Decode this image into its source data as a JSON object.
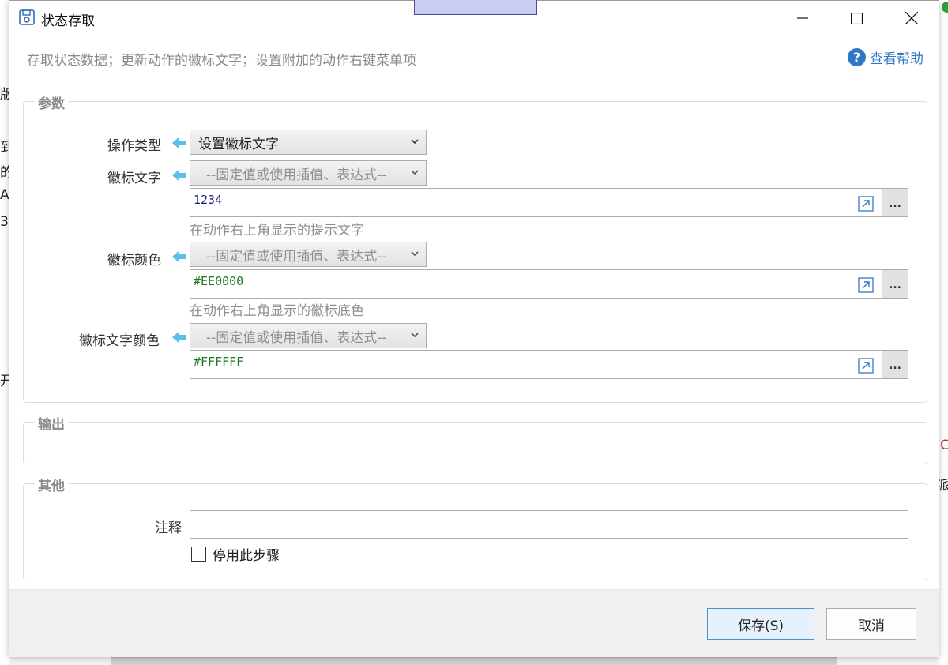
{
  "window": {
    "title": "状态存取",
    "description": "存取状态数据；更新动作的徽标文字；设置附加的动作右键菜单项",
    "help_label": "查看帮助",
    "help_icon": "question-icon"
  },
  "background": {
    "left_chars": [
      "版",
      "到",
      "的",
      "A",
      "3",
      "开"
    ],
    "right_chars": [
      "C",
      "派"
    ]
  },
  "params": {
    "legend": "参数",
    "operation_type": {
      "label": "操作类型",
      "value": "设置徽标文字"
    },
    "badge_text": {
      "label": "徽标文字",
      "mode_placeholder": "--固定值或使用插值、表达式--",
      "value": "1234",
      "hint": "在动作右上角显示的提示文字"
    },
    "badge_color": {
      "label": "徽标颜色",
      "mode_placeholder": "--固定值或使用插值、表达式--",
      "value": "#EE0000",
      "hint": "在动作右上角显示的徽标底色"
    },
    "badge_text_color": {
      "label": "徽标文字颜色",
      "mode_placeholder": "--固定值或使用插值、表达式--",
      "value": "#FFFFFF"
    },
    "dots_label": "..."
  },
  "output": {
    "legend": "输出"
  },
  "other": {
    "legend": "其他",
    "comment_label": "注释",
    "comment_value": "",
    "disable_step_label": "停用此步骤",
    "disable_step_checked": false
  },
  "footer": {
    "save_label": "保存(S)",
    "cancel_label": "取消"
  },
  "colors": {
    "accent": "#2f78c8",
    "arrow": "#5bc0e8",
    "value_blue": "#1a1a8c",
    "value_green": "#1f7a1f"
  }
}
